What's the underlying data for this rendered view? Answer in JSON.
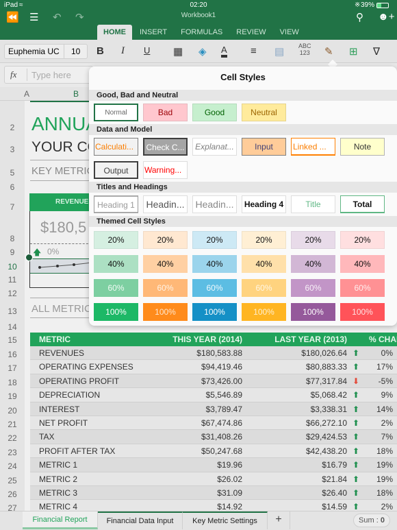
{
  "status_bar": {
    "device": "iPad",
    "time": "02:20",
    "battery": "39%"
  },
  "title_bar": {
    "workbook_title": "Workbook1"
  },
  "ribbon_tabs": [
    "HOME",
    "INSERT",
    "FORMULAS",
    "REVIEW",
    "VIEW"
  ],
  "active_tab": "HOME",
  "ribbon": {
    "font_name": "Euphemia UC",
    "font_size": "10",
    "bold": "B",
    "italic": "I",
    "underline": "U",
    "number_format": "ABC\n123"
  },
  "formula_bar": {
    "fx": "fx",
    "placeholder": "Type here"
  },
  "grid": {
    "col_headers": [
      "A",
      "B"
    ],
    "row_headers": [
      "2",
      "3",
      "5",
      "6",
      "7",
      "8",
      "9",
      "10",
      "11",
      "12",
      "13",
      "14",
      "15",
      "16",
      "17",
      "18",
      "19",
      "20",
      "21",
      "22",
      "23",
      "24",
      "25",
      "26",
      "27"
    ],
    "title": "ANNUAL",
    "subtitle": "YOUR CO",
    "key_metrics": "KEY METRIC",
    "revenue_label": "REVENUE",
    "revenue_value": "$180,5",
    "revenue_change": "0%",
    "all_metrics": "ALL METRIC"
  },
  "table": {
    "headers": [
      "METRIC",
      "THIS YEAR (2014)",
      "LAST YEAR (2013)",
      "",
      "% CHANGE"
    ],
    "rows": [
      {
        "metric": "REVENUES",
        "this_year": "$180,583.88",
        "last_year": "$180,026.64",
        "trend": "up",
        "change": "0%"
      },
      {
        "metric": "OPERATING EXPENSES",
        "this_year": "$94,419.46",
        "last_year": "$80,883.33",
        "trend": "up",
        "change": "17%"
      },
      {
        "metric": "OPERATING PROFIT",
        "this_year": "$73,426.00",
        "last_year": "$77,317.84",
        "trend": "down",
        "change": "-5%"
      },
      {
        "metric": "DEPRECIATION",
        "this_year": "$5,546.89",
        "last_year": "$5,068.42",
        "trend": "up",
        "change": "9%"
      },
      {
        "metric": "INTEREST",
        "this_year": "$3,789.47",
        "last_year": "$3,338.31",
        "trend": "up",
        "change": "14%"
      },
      {
        "metric": "NET PROFIT",
        "this_year": "$67,474.86",
        "last_year": "$66,272.10",
        "trend": "up",
        "change": "2%"
      },
      {
        "metric": "TAX",
        "this_year": "$31,408.26",
        "last_year": "$29,424.53",
        "trend": "up",
        "change": "7%"
      },
      {
        "metric": "PROFIT AFTER TAX",
        "this_year": "$50,247.68",
        "last_year": "$42,438.20",
        "trend": "up",
        "change": "18%"
      },
      {
        "metric": "METRIC 1",
        "this_year": "$19.96",
        "last_year": "$16.79",
        "trend": "up",
        "change": "19%"
      },
      {
        "metric": "METRIC 2",
        "this_year": "$26.02",
        "last_year": "$21.84",
        "trend": "up",
        "change": "19%"
      },
      {
        "metric": "METRIC 3",
        "this_year": "$31.09",
        "last_year": "$26.40",
        "trend": "up",
        "change": "18%"
      },
      {
        "metric": "METRIC 4",
        "this_year": "$14.92",
        "last_year": "$14.59",
        "trend": "up",
        "change": "2%"
      }
    ]
  },
  "cell_styles": {
    "title": "Cell Styles",
    "sections": [
      {
        "name": "Good, Bad and Neutral",
        "rows": [
          [
            {
              "label": "Normal",
              "bg": "#ffffff",
              "fg": "#666666",
              "border": "#217346"
            },
            {
              "label": "Bad",
              "bg": "#ffc7ce",
              "fg": "#9c0006",
              "border": "#e6b8be"
            },
            {
              "label": "Good",
              "bg": "#c6efce",
              "fg": "#006100",
              "border": "#b4dcbc"
            },
            {
              "label": "Neutral",
              "bg": "#ffeb9c",
              "fg": "#9c6500",
              "border": "#e6d48c"
            }
          ]
        ]
      },
      {
        "name": "Data and Model",
        "rows": [
          [
            {
              "label": "Calculati...",
              "bg": "#f2f2f2",
              "fg": "#fa7d00",
              "border": "#7f7f7f"
            },
            {
              "label": "Check C...",
              "bg": "#a5a5a5",
              "fg": "#ffffff",
              "border": "#3f3f3f"
            },
            {
              "label": "Explanat...",
              "bg": "#ffffff",
              "fg": "#7f7f7f",
              "border": "#dddddd"
            },
            {
              "label": "Input",
              "bg": "#ffcc99",
              "fg": "#3f3f76",
              "border": "#7f7f7f"
            },
            {
              "label": "Linked ...",
              "bg": "#ffffff",
              "fg": "#fa7d00",
              "border": "#ff8001"
            },
            {
              "label": "Note",
              "bg": "#ffffcc",
              "fg": "#333333",
              "border": "#b2b2b2"
            }
          ],
          [
            {
              "label": "Output",
              "bg": "#f2f2f2",
              "fg": "#3f3f3f",
              "border": "#3f3f3f"
            },
            {
              "label": "Warning...",
              "bg": "#ffffff",
              "fg": "#ff0000",
              "border": "#dddddd"
            }
          ]
        ]
      },
      {
        "name": "Titles and Headings",
        "rows": [
          [
            {
              "label": "Heading 1",
              "bg": "#ffffff",
              "fg": "#999999",
              "border": "#999999"
            },
            {
              "label": "Headin...",
              "bg": "#ffffff",
              "fg": "#555555",
              "border": "#dddddd"
            },
            {
              "label": "Headin...",
              "bg": "#ffffff",
              "fg": "#888888",
              "border": "#dddddd"
            },
            {
              "label": "Heading 4",
              "bg": "#ffffff",
              "fg": "#111111",
              "border": "#dddddd"
            },
            {
              "label": "Title",
              "bg": "#ffffff",
              "fg": "#5fb784",
              "border": "#dddddd"
            },
            {
              "label": "Total",
              "bg": "#ffffff",
              "fg": "#111111",
              "border": "#5fb784"
            }
          ]
        ]
      },
      {
        "name": "Themed Cell Styles",
        "rows": [
          [
            {
              "label": "20%",
              "bg": "#d5efe1",
              "fg": "#111111",
              "border": "#c9e2d5"
            },
            {
              "label": "20%",
              "bg": "#ffe8d1",
              "fg": "#111111",
              "border": "#f0dac5"
            },
            {
              "label": "20%",
              "bg": "#cde9f5",
              "fg": "#111111",
              "border": "#c0dce8"
            },
            {
              "label": "20%",
              "bg": "#ffefd4",
              "fg": "#111111",
              "border": "#f0e1c7"
            },
            {
              "label": "20%",
              "bg": "#e8dbe9",
              "fg": "#111111",
              "border": "#dacedc"
            },
            {
              "label": "20%",
              "bg": "#ffdfe0",
              "fg": "#111111",
              "border": "#f0d2d3"
            }
          ],
          [
            {
              "label": "40%",
              "bg": "#ace0c3",
              "fg": "#111111",
              "border": "#ace0c3"
            },
            {
              "label": "40%",
              "bg": "#ffd0a3",
              "fg": "#111111",
              "border": "#ffd0a3"
            },
            {
              "label": "40%",
              "bg": "#9bd4ec",
              "fg": "#111111",
              "border": "#9bd4ec"
            },
            {
              "label": "40%",
              "bg": "#ffe0aa",
              "fg": "#111111",
              "border": "#ffe0aa"
            },
            {
              "label": "40%",
              "bg": "#d2b7d5",
              "fg": "#111111",
              "border": "#d2b7d5"
            },
            {
              "label": "40%",
              "bg": "#ffb8bb",
              "fg": "#111111",
              "border": "#ffb8bb"
            }
          ],
          [
            {
              "label": "60%",
              "bg": "#7dcfa1",
              "fg": "#f1fbf5",
              "border": "#7dcfa1"
            },
            {
              "label": "60%",
              "bg": "#ffb877",
              "fg": "#fff3e6",
              "border": "#ffb877"
            },
            {
              "label": "60%",
              "bg": "#5cbde3",
              "fg": "#f0f9fd",
              "border": "#5cbde3"
            },
            {
              "label": "60%",
              "bg": "#ffd37f",
              "fg": "#fff7e6",
              "border": "#ffd37f"
            },
            {
              "label": "60%",
              "bg": "#c295c7",
              "fg": "#f8f1f8",
              "border": "#c295c7"
            },
            {
              "label": "60%",
              "bg": "#ff9194",
              "fg": "#ffeeee",
              "border": "#ff9194"
            }
          ],
          [
            {
              "label": "100%",
              "bg": "#1db866",
              "fg": "#ffffff",
              "border": "#1db866"
            },
            {
              "label": "100%",
              "bg": "#ff8b1b",
              "fg": "#ffe7cf",
              "border": "#ff8b1b"
            },
            {
              "label": "100%",
              "bg": "#1590c6",
              "fg": "#ffffff",
              "border": "#1590c6"
            },
            {
              "label": "100%",
              "bg": "#ffb522",
              "fg": "#fff0d0",
              "border": "#ffb522"
            },
            {
              "label": "100%",
              "bg": "#95599b",
              "fg": "#ffffff",
              "border": "#95599b"
            },
            {
              "label": "100%",
              "bg": "#ff5359",
              "fg": "#ffe3e4",
              "border": "#ff5359"
            }
          ]
        ]
      }
    ]
  },
  "sheet_tabs": [
    "Financial Report",
    "Financial Data Input",
    "Key Metric Settings"
  ],
  "active_sheet": "Financial Report",
  "add_sheet": "+",
  "sum_label": "Sum : ",
  "sum_value": "0",
  "colors": {
    "brand": "#217346",
    "table_header": "#21a35a",
    "up": "#1e8f4e",
    "down": "#e34a3a"
  }
}
